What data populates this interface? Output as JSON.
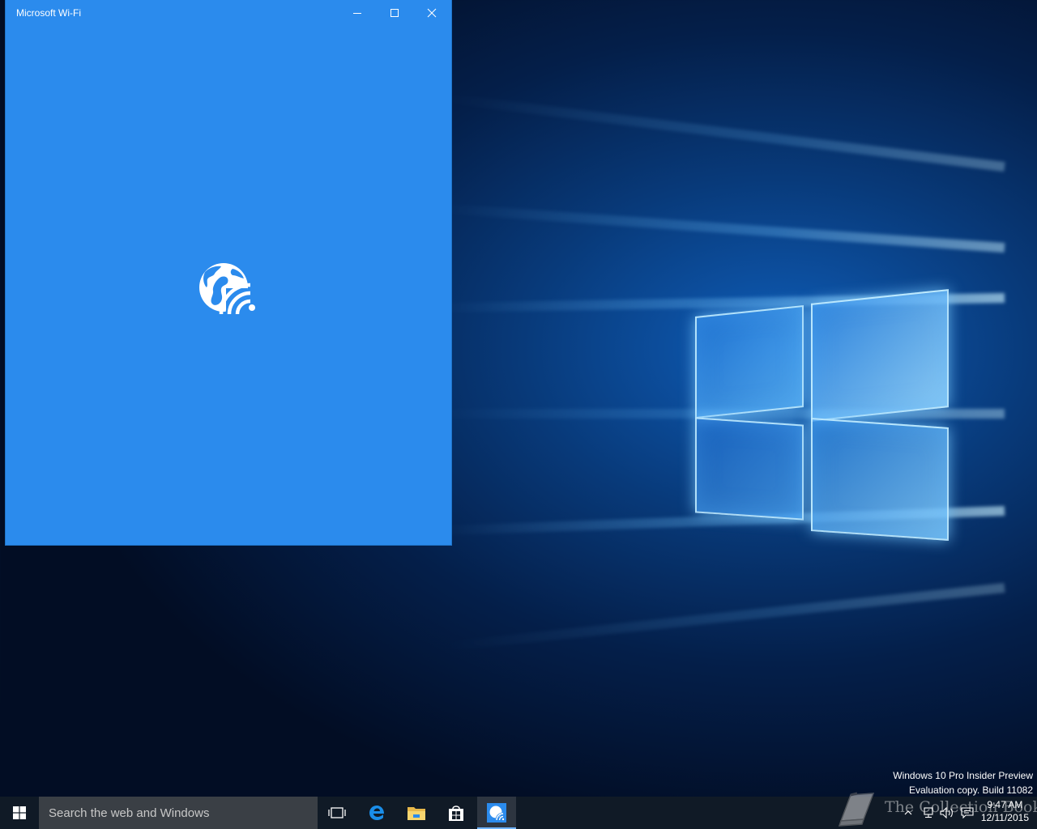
{
  "app_window": {
    "title": "Microsoft Wi-Fi",
    "background_color": "#2b8bed",
    "logo_icon": "globe-wifi-icon"
  },
  "desktop": {
    "watermark_line1": "Windows 10 Pro Insider Preview",
    "watermark_line2": "Evaluation copy. Build 11082",
    "overlay_text": "The Collection Book"
  },
  "taskbar": {
    "search_placeholder": "Search the web and Windows",
    "pinned": [
      "task-view-icon",
      "edge-icon",
      "file-explorer-icon",
      "store-icon",
      "microsoft-wifi-icon"
    ],
    "clock_time": "9:47 AM",
    "clock_date": "12/11/2015"
  }
}
